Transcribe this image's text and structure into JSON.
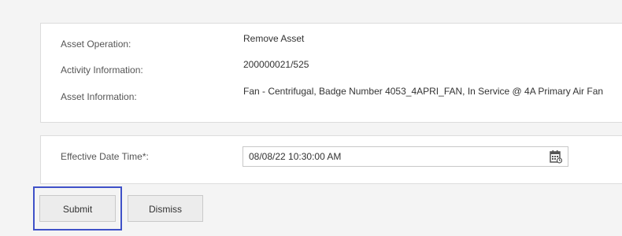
{
  "asset_info": {
    "rows": [
      {
        "label": "Asset Operation:",
        "value": "Remove Asset"
      },
      {
        "label": "Activity Information:",
        "value": "200000021/525"
      },
      {
        "label": "Asset Information:",
        "value": "Fan - Centrifugal, Badge Number 4053_4APRI_FAN, In Service @ 4A Primary Air Fan"
      }
    ]
  },
  "effective_date": {
    "label": "Effective Date Time*:",
    "value": "08/08/22 10:30:00 AM",
    "icon": "calendar-icon"
  },
  "actions": {
    "submit_label": "Submit",
    "dismiss_label": "Dismiss",
    "focused": "submit",
    "focus_color": "#3f51c8"
  }
}
